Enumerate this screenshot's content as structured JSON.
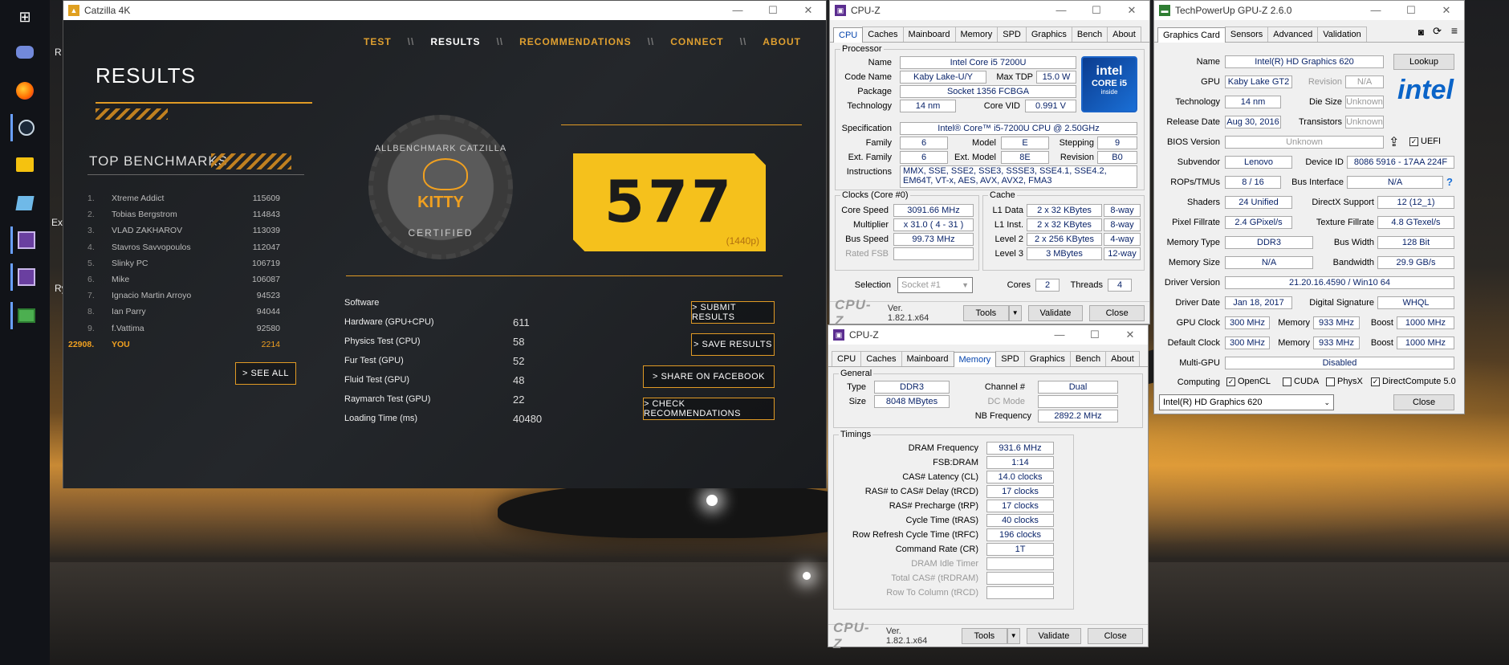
{
  "taskbar": {
    "icons": [
      "windows-icon",
      "discord-icon",
      "firefox-icon",
      "steam-icon",
      "folder-icon",
      "notes-icon",
      "cpuz-icon",
      "cpuz-icon-2",
      "gpuz-icon"
    ],
    "desk_labels": [
      "R",
      "Ext",
      "Ry"
    ]
  },
  "catzilla": {
    "title": "Catzilla 4K",
    "nav": {
      "test": "TEST",
      "results": "RESULTS",
      "recommendations": "RECOMMENDATIONS",
      "connect": "CONNECT",
      "about": "ABOUT",
      "sep": "\\\\"
    },
    "results_title": "RESULTS",
    "top_benchmarks": "TOP BENCHMARKS",
    "leaderboard": [
      {
        "rank": "1.",
        "name": "Xtreme Addict",
        "score": "115609"
      },
      {
        "rank": "2.",
        "name": "Tobias Bergstrom",
        "score": "114843"
      },
      {
        "rank": "3.",
        "name": "VLAD ZAKHAROV",
        "score": "113039"
      },
      {
        "rank": "4.",
        "name": "Stavros Savvopoulos",
        "score": "112047"
      },
      {
        "rank": "5.",
        "name": "Slinky PC",
        "score": "106719"
      },
      {
        "rank": "6.",
        "name": "Mike",
        "score": "106087"
      },
      {
        "rank": "7.",
        "name": "Ignacio Martin Arroyo",
        "score": "94523"
      },
      {
        "rank": "8.",
        "name": "Ian Parry",
        "score": "94044"
      },
      {
        "rank": "9.",
        "name": "f.Vattima",
        "score": "92580"
      },
      {
        "rank": "22908.",
        "name": "YOU",
        "score": "2214"
      }
    ],
    "see_all": "> SEE ALL",
    "medal": {
      "top": "ALLBENCHMARK CATZILLA",
      "name": "KITTY",
      "bottom": "CERTIFIED"
    },
    "score": "577",
    "resolution": "(1440p)",
    "software_label": "Software",
    "results": [
      {
        "label": "Hardware (GPU+CPU)",
        "value": "611"
      },
      {
        "label": "Physics Test (CPU)",
        "value": "58"
      },
      {
        "label": "Fur Test (GPU)",
        "value": "52"
      },
      {
        "label": "Fluid Test (GPU)",
        "value": "48"
      },
      {
        "label": "Raymarch Test (GPU)",
        "value": "22"
      },
      {
        "label": "Loading Time (ms)",
        "value": "40480"
      }
    ],
    "buttons": {
      "submit": "> SUBMIT RESULTS",
      "save": "> SAVE RESULTS",
      "facebook": "> SHARE ON FACEBOOK",
      "check": "> CHECK RECOMMENDATIONS"
    }
  },
  "cpuz_cpu": {
    "title": "CPU-Z",
    "tabs": [
      "CPU",
      "Caches",
      "Mainboard",
      "Memory",
      "SPD",
      "Graphics",
      "Bench",
      "About"
    ],
    "processor_group": "Processor",
    "name_label": "Name",
    "name": "Intel Core i5 7200U",
    "codename_label": "Code Name",
    "codename": "Kaby Lake-U/Y",
    "maxtdp_label": "Max TDP",
    "maxtdp": "15.0 W",
    "package_label": "Package",
    "package": "Socket 1356 FCBGA",
    "technology_label": "Technology",
    "technology": "14 nm",
    "corevid_label": "Core VID",
    "corevid": "0.991 V",
    "spec_label": "Specification",
    "spec": "Intel® Core™ i5-7200U CPU @ 2.50GHz",
    "family_label": "Family",
    "family": "6",
    "model_label": "Model",
    "model": "E",
    "stepping_label": "Stepping",
    "stepping": "9",
    "extfamily_label": "Ext. Family",
    "extfamily": "6",
    "extmodel_label": "Ext. Model",
    "extmodel": "8E",
    "revision_label": "Revision",
    "revision": "B0",
    "instr_label": "Instructions",
    "instructions": "MMX, SSE, SSE2, SSE3, SSSE3, SSE4.1, SSE4.2, EM64T, VT-x, AES, AVX, AVX2, FMA3",
    "logo": {
      "brand": "intel",
      "line": "CORE i5",
      "sub": "inside"
    },
    "clocks_group": "Clocks (Core #0)",
    "corespeed_label": "Core Speed",
    "corespeed": "3091.66 MHz",
    "multiplier_label": "Multiplier",
    "multiplier": "x 31.0 ( 4 - 31 )",
    "busspeed_label": "Bus Speed",
    "busspeed": "99.73 MHz",
    "ratedfsb_label": "Rated FSB",
    "ratedfsb": "",
    "cache_group": "Cache",
    "l1d_label": "L1 Data",
    "l1d": "2 x 32 KBytes",
    "l1d_way": "8-way",
    "l1i_label": "L1 Inst.",
    "l1i": "2 x 32 KBytes",
    "l1i_way": "8-way",
    "l2_label": "Level 2",
    "l2": "2 x 256 KBytes",
    "l2_way": "4-way",
    "l3_label": "Level 3",
    "l3": "3 MBytes",
    "l3_way": "12-way",
    "selection_label": "Selection",
    "selection": "Socket #1",
    "cores_label": "Cores",
    "cores": "2",
    "threads_label": "Threads",
    "threads": "4",
    "logo_text": "CPU-Z",
    "version": "Ver. 1.82.1.x64",
    "tools": "Tools",
    "validate": "Validate",
    "close": "Close"
  },
  "cpuz_mem": {
    "title": "CPU-Z",
    "tabs": [
      "CPU",
      "Caches",
      "Mainboard",
      "Memory",
      "SPD",
      "Graphics",
      "Bench",
      "About"
    ],
    "general_group": "General",
    "type_label": "Type",
    "type": "DDR3",
    "channel_label": "Channel #",
    "channel": "Dual",
    "size_label": "Size",
    "size": "8048 MBytes",
    "dcmode_label": "DC Mode",
    "dcmode": "",
    "nbfreq_label": "NB Frequency",
    "nbfreq": "2892.2 MHz",
    "timings_group": "Timings",
    "timings": [
      {
        "label": "DRAM Frequency",
        "value": "931.6 MHz",
        "dim": false
      },
      {
        "label": "FSB:DRAM",
        "value": "1:14",
        "dim": false
      },
      {
        "label": "CAS# Latency (CL)",
        "value": "14.0 clocks",
        "dim": false
      },
      {
        "label": "RAS# to CAS# Delay (tRCD)",
        "value": "17 clocks",
        "dim": false
      },
      {
        "label": "RAS# Precharge (tRP)",
        "value": "17 clocks",
        "dim": false
      },
      {
        "label": "Cycle Time (tRAS)",
        "value": "40 clocks",
        "dim": false
      },
      {
        "label": "Row Refresh Cycle Time (tRFC)",
        "value": "196 clocks",
        "dim": false
      },
      {
        "label": "Command Rate (CR)",
        "value": "1T",
        "dim": false
      },
      {
        "label": "DRAM Idle Timer",
        "value": "",
        "dim": true
      },
      {
        "label": "Total CAS# (tRDRAM)",
        "value": "",
        "dim": true
      },
      {
        "label": "Row To Column (tRCD)",
        "value": "",
        "dim": true
      }
    ],
    "logo_text": "CPU-Z",
    "version": "Ver. 1.82.1.x64",
    "tools": "Tools",
    "validate": "Validate",
    "close": "Close"
  },
  "gpuz": {
    "title": "TechPowerUp GPU-Z 2.6.0",
    "tabs": [
      "Graphics Card",
      "Sensors",
      "Advanced",
      "Validation"
    ],
    "name_label": "Name",
    "name": "Intel(R) HD Graphics 620",
    "lookup": "Lookup",
    "gpu_label": "GPU",
    "gpu": "Kaby Lake GT2",
    "revision_label": "Revision",
    "revision": "N/A",
    "technology_label": "Technology",
    "technology": "14 nm",
    "diesize_label": "Die Size",
    "diesize": "Unknown",
    "release_label": "Release Date",
    "release": "Aug 30, 2016",
    "transistors_label": "Transistors",
    "transistors": "Unknown",
    "bios_label": "BIOS Version",
    "bios": "Unknown",
    "uefi": "UEFI",
    "subvendor_label": "Subvendor",
    "subvendor": "Lenovo",
    "deviceid_label": "Device ID",
    "deviceid": "8086 5916 - 17AA 224F",
    "rops_label": "ROPs/TMUs",
    "rops": "8 / 16",
    "busif_label": "Bus Interface",
    "busif": "N/A",
    "help": "?",
    "shaders_label": "Shaders",
    "shaders": "24 Unified",
    "dx_label": "DirectX Support",
    "dx": "12 (12_1)",
    "pixel_label": "Pixel Fillrate",
    "pixel": "2.4 GPixel/s",
    "texture_label": "Texture Fillrate",
    "texture": "4.8 GTexel/s",
    "memtype_label": "Memory Type",
    "memtype": "DDR3",
    "buswidth_label": "Bus Width",
    "buswidth": "128 Bit",
    "memsize_label": "Memory Size",
    "memsize": "N/A",
    "bandwidth_label": "Bandwidth",
    "bandwidth": "29.9 GB/s",
    "driver_label": "Driver Version",
    "driver": "21.20.16.4590 / Win10 64",
    "driverdate_label": "Driver Date",
    "driverdate": "Jan 18, 2017",
    "digsig_label": "Digital Signature",
    "digsig": "WHQL",
    "gpuclock_label": "GPU Clock",
    "gpuclock": "300 MHz",
    "mem_label": "Memory",
    "gpumem": "933 MHz",
    "boost_label": "Boost",
    "boost": "1000 MHz",
    "defclock_label": "Default Clock",
    "defclock": "300 MHz",
    "defmem": "933 MHz",
    "defboost": "1000 MHz",
    "multigpu_label": "Multi-GPU",
    "multigpu": "Disabled",
    "computing_label": "Computing",
    "opencl": "OpenCL",
    "cuda": "CUDA",
    "physx": "PhysX",
    "dc": "DirectCompute 5.0",
    "device_select": "Intel(R) HD Graphics 620",
    "close": "Close",
    "logo": "intel"
  }
}
